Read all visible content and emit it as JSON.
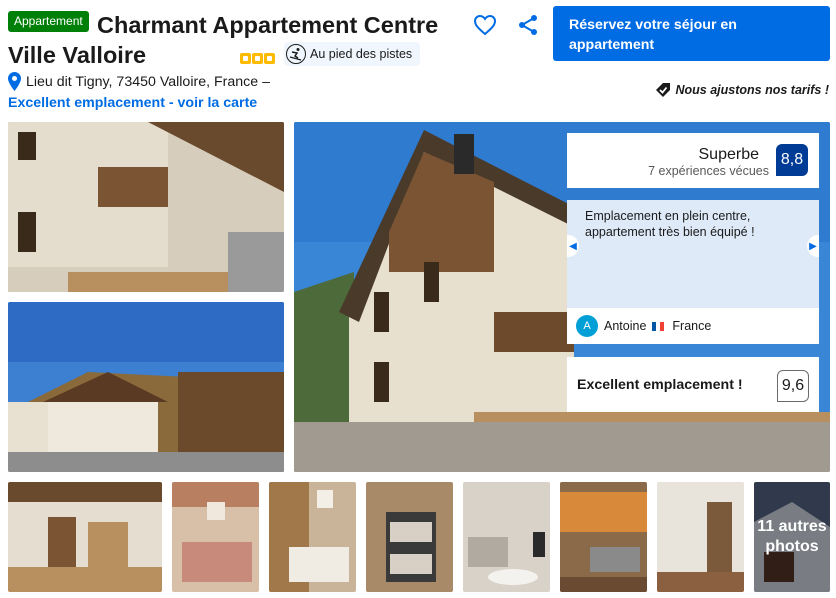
{
  "header": {
    "type_badge": "Appartement",
    "title": "Charmant Appartement Centre Ville Valloire",
    "stars": 3,
    "ski_tag": "Au pied des pistes",
    "address": "Lieu dit Tigny, 73450 Valloire, France –",
    "map_link": "Excellent emplacement - voir la carte"
  },
  "actions": {
    "reserve_label": "Réservez votre séjour en appartement",
    "price_match": "Nous ajustons nos tarifs !"
  },
  "review": {
    "score_word": "Superbe",
    "review_count": "7 expériences vécues",
    "score": "8,8",
    "quote": "Emplacement en plein centre, appartement très bien équipé !",
    "reviewer_initial": "A",
    "reviewer_name": "Antoine",
    "reviewer_country": "France",
    "location_label": "Excellent emplacement !",
    "location_score": "9,6"
  },
  "gallery": {
    "more_photos": "11 autres photos"
  },
  "colors": {
    "brand_blue": "#006ce4",
    "score_blue": "#003b95",
    "badge_green": "#008009",
    "star_yellow": "#febb02"
  }
}
